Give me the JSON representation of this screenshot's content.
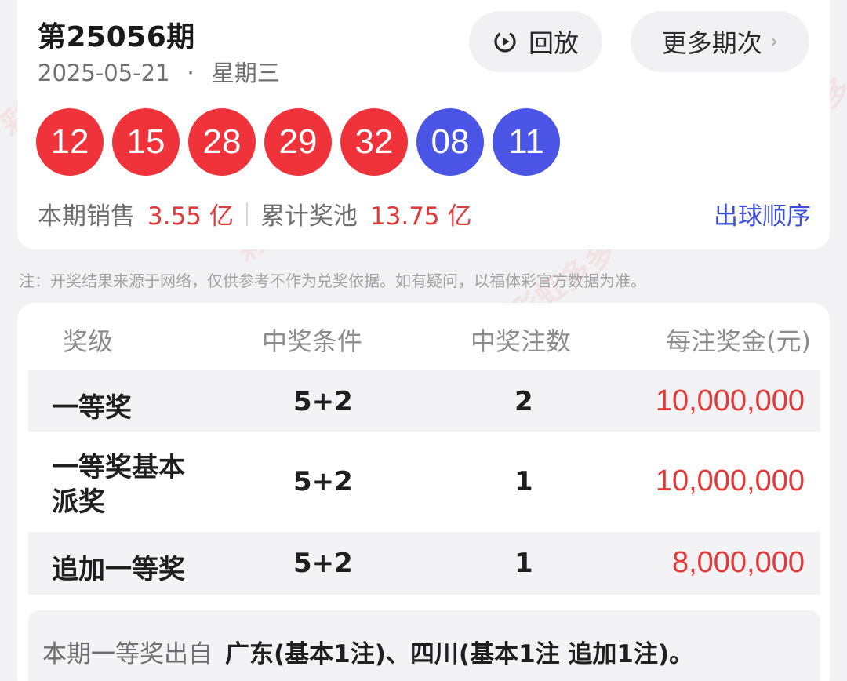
{
  "header": {
    "issue_title": "第25056期",
    "date": "2025-05-21",
    "separator": "·",
    "weekday": "星期三",
    "replay_label": "回放",
    "more_label": "更多期次",
    "more_chevron": "›"
  },
  "balls": {
    "red": [
      "12",
      "15",
      "28",
      "29",
      "32"
    ],
    "blue": [
      "08",
      "11"
    ],
    "colors": {
      "red": "#f0323a",
      "blue": "#4a55e6"
    }
  },
  "sales": {
    "sales_label": "本期销售",
    "sales_value": "3.55 亿",
    "pool_label": "累计奖池",
    "pool_value": "13.75 亿",
    "order_link": "出球顺序"
  },
  "note": "注：开奖结果来源于网络，仅供参考不作为兑奖依据。如有疑问，以福体彩官方数据为准。",
  "table": {
    "headers": [
      "奖级",
      "中奖条件",
      "中奖注数",
      "每注奖金(元)"
    ],
    "rows": [
      {
        "level": "一等奖",
        "condition": "5+2",
        "count": "2",
        "prize": "10,000,000"
      },
      {
        "level": "一等奖基本派奖",
        "condition": "5+2",
        "count": "1",
        "prize": "10,000,000"
      },
      {
        "level": "追加一等奖",
        "condition": "5+2",
        "count": "1",
        "prize": "8,000,000"
      }
    ]
  },
  "winner": {
    "label": "本期一等奖出自",
    "detail": "广东(基本1注)、四川(基本1注 追加1注)。"
  },
  "watermark": "彩虹多多",
  "icons": {
    "replay": "replay-icon",
    "chevron": "chevron-right-icon"
  }
}
